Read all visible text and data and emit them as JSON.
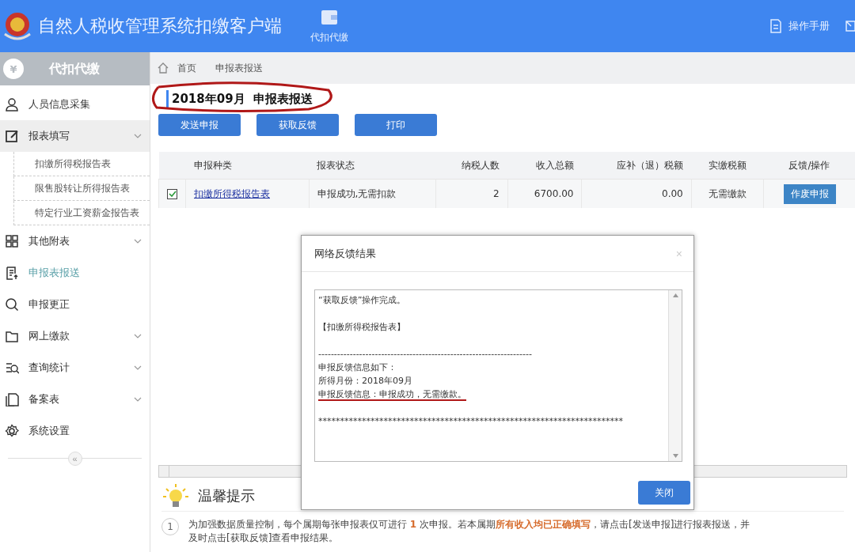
{
  "header": {
    "title": "自然人税收管理系统扣缴客户端",
    "nav": [
      {
        "label": "代扣代缴"
      }
    ],
    "links": [
      {
        "label": "操作手册"
      }
    ]
  },
  "sidebar": {
    "badge": "¥",
    "title": "代扣代缴",
    "items": [
      {
        "label": "人员信息采集",
        "kind": "link",
        "selected": false
      },
      {
        "label": "报表填写",
        "kind": "group",
        "selected": false,
        "expanded": true,
        "children": [
          {
            "label": "扣缴所得税报告表"
          },
          {
            "label": "限售股转让所得报告表"
          },
          {
            "label": "特定行业工资薪金报告表"
          }
        ]
      },
      {
        "label": "其他附表",
        "kind": "group",
        "selected": false,
        "expanded": false
      },
      {
        "label": "申报表报送",
        "kind": "link",
        "selected": true
      },
      {
        "label": "申报更正",
        "kind": "link",
        "selected": false
      },
      {
        "label": "网上缴款",
        "kind": "group",
        "selected": false,
        "expanded": false
      },
      {
        "label": "查询统计",
        "kind": "group",
        "selected": false,
        "expanded": false
      },
      {
        "label": "备案表",
        "kind": "group",
        "selected": false,
        "expanded": false
      },
      {
        "label": "系统设置",
        "kind": "link",
        "selected": false
      }
    ],
    "collapse": "«"
  },
  "breadcrumb": [
    "首页",
    "申报表报送"
  ],
  "page_title": "2018年09月  申报表报送",
  "toolbar": [
    "发送申报",
    "获取反馈",
    "打印"
  ],
  "table": {
    "columns": [
      "申报种类",
      "报表状态",
      "纳税人数",
      "收入总额",
      "应补（退）税额",
      "实缴税额",
      "反馈/操作"
    ],
    "rows": [
      {
        "checked": true,
        "name": "扣缴所得税报告表",
        "status": "申报成功,无需扣款",
        "count": "2",
        "income": "6700.00",
        "tax_due": "0.00",
        "paid": "无需缴款",
        "action": "作废申报"
      }
    ]
  },
  "dialog": {
    "title": "网络反馈结果",
    "close": "×",
    "lines": [
      {
        "text": "“获取反馈”操作完成。",
        "underlined": false
      },
      {
        "text": "【扣缴所得税报告表】",
        "underlined": false
      },
      {
        "text": "--------------------------------------------------------------------",
        "underlined": false
      },
      {
        "text": "申报反馈信息如下：",
        "underlined": false
      },
      {
        "text": "所得月份：2018年09月",
        "underlined": false
      },
      {
        "text": "申报反馈信息：申报成功，无需缴款。",
        "underlined": true
      },
      {
        "text": "**********************************************************************",
        "underlined": false
      }
    ],
    "button": "关闭"
  },
  "tips": {
    "title": "温馨提示",
    "items": [
      {
        "number": "1",
        "text": "为加强数据质量控制，每个属期每张申报表仅可进行 **1** 次申报。若本属期**所有收入均已正确填写**，请点击[发送申报]进行报表报送，并及时点击[获取反馈]查看申报结果。"
      }
    ]
  }
}
